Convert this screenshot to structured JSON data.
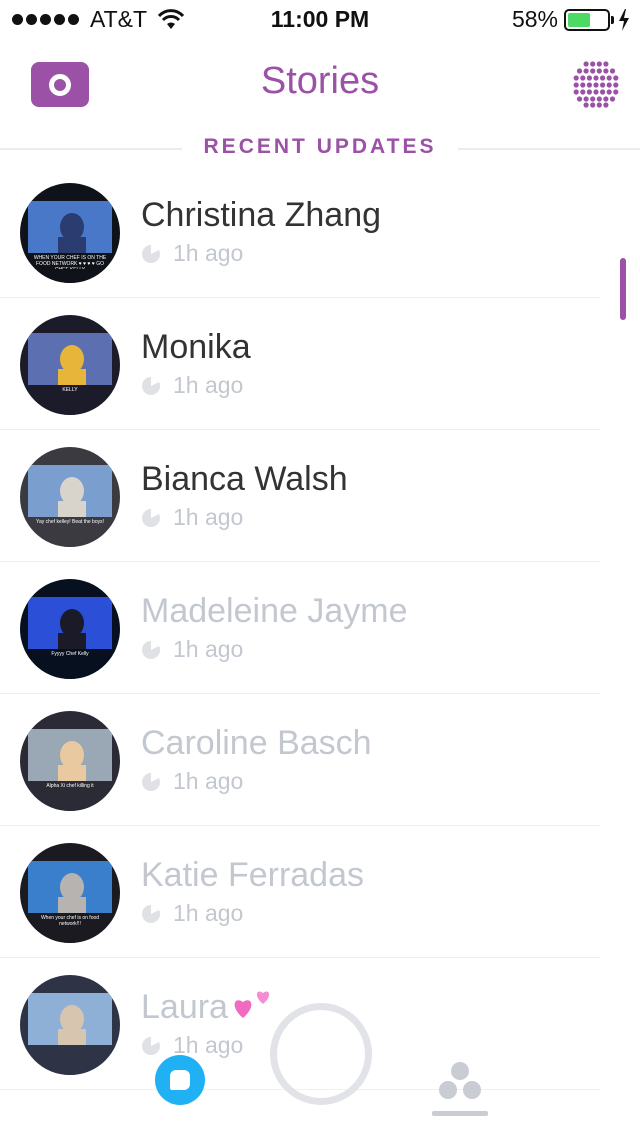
{
  "status_bar": {
    "carrier": "AT&T",
    "time": "11:00 PM",
    "battery": "58%",
    "battery_level": 0.58
  },
  "header": {
    "title": "Stories",
    "camera_icon": "camera-icon",
    "discover_icon": "discover-icon"
  },
  "section": {
    "title": "RECENT UPDATES"
  },
  "stories": [
    {
      "name": "Christina Zhang",
      "time": "1h ago",
      "viewed": false,
      "avatar_caption": "WHEN YOUR CHEF IS ON THE FOOD NETWORK ♥ ♥ ♥ ♥ GO CHEF KELLY"
    },
    {
      "name": "Monika",
      "time": "1h ago",
      "viewed": false,
      "avatar_caption": "KELLY"
    },
    {
      "name": "Bianca Walsh",
      "time": "1h ago",
      "viewed": false,
      "avatar_caption": "Yay chef kelley! Beat the boys!"
    },
    {
      "name": "Madeleine Jayme",
      "time": "1h ago",
      "viewed": true,
      "avatar_caption": "Fyyyy Chef Kelly"
    },
    {
      "name": "Caroline Basch",
      "time": "1h ago",
      "viewed": true,
      "avatar_caption": "Alpha Xi chef killing it"
    },
    {
      "name": "Katie Ferradas",
      "time": "1h ago",
      "viewed": true,
      "avatar_caption": "When your chef is on food network!!!"
    },
    {
      "name": "Laura",
      "time": "1h ago",
      "viewed": true,
      "avatar_caption": ""
    }
  ],
  "nav": {
    "chat_icon": "chat-icon",
    "capture_icon": "capture-button-icon",
    "friends_icon": "friends-icon"
  },
  "colors": {
    "accent": "#9b52a6",
    "chat": "#1fb1f4",
    "battery": "#4cd964",
    "viewed_text": "#c3c7cf"
  }
}
